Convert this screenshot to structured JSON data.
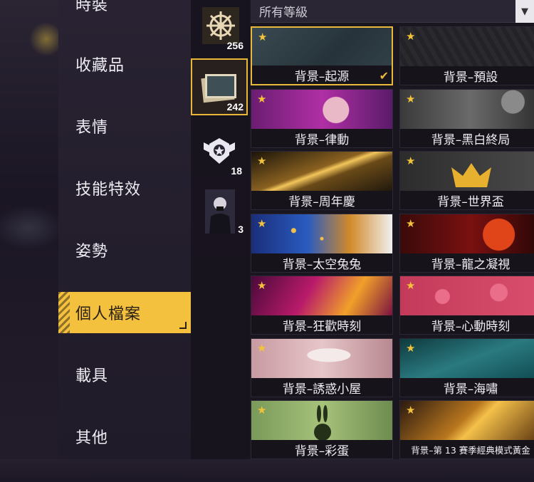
{
  "sidebar": {
    "items": [
      {
        "label": "時裝"
      },
      {
        "label": "收藏品"
      },
      {
        "label": "表情"
      },
      {
        "label": "技能特效"
      },
      {
        "label": "姿勢"
      },
      {
        "label": "個人檔案",
        "active": true
      },
      {
        "label": "載具"
      },
      {
        "label": "其他"
      }
    ]
  },
  "categories": [
    {
      "icon": "ship-wheel-icon",
      "count": "256"
    },
    {
      "icon": "photo-card-icon",
      "count": "242",
      "selected": true
    },
    {
      "icon": "rank-badge-icon",
      "count": "18"
    },
    {
      "icon": "avatar-portrait-icon",
      "count": "3"
    }
  ],
  "filter": {
    "label": "所有等級"
  },
  "tiles": [
    {
      "label": "背景–起源",
      "selected": true
    },
    {
      "label": "背景–預設"
    },
    {
      "label": "背景–律動"
    },
    {
      "label": "背景–黑白終局"
    },
    {
      "label": "背景–周年慶"
    },
    {
      "label": "背景–世界盃"
    },
    {
      "label": "背景–太空兔兔"
    },
    {
      "label": "背景–龍之凝視"
    },
    {
      "label": "背景–狂歡時刻"
    },
    {
      "label": "背景–心動時刻"
    },
    {
      "label": "背景–誘惑小屋"
    },
    {
      "label": "背景–海嘯"
    },
    {
      "label": "背景–彩蛋"
    },
    {
      "label": "背景–第 13 賽季經典模式黃金"
    }
  ],
  "colors": {
    "accent": "#f4c13e",
    "star": "#f2c33a"
  }
}
